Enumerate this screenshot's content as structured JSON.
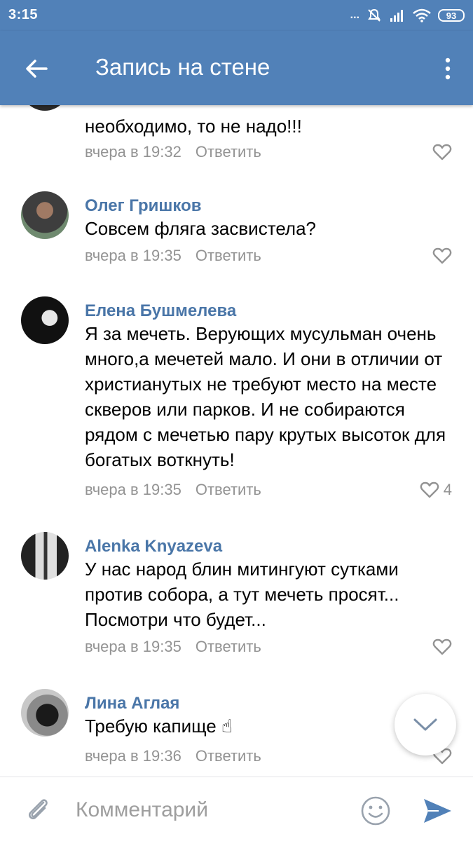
{
  "status_bar": {
    "time": "3:15",
    "signal_dots": "...",
    "battery": "93"
  },
  "toolbar": {
    "title": "Запись на стене",
    "back_icon": "arrow-left-icon",
    "menu_icon": "more-vertical-icon"
  },
  "comments": [
    {
      "author": "",
      "text": "необходимо, то не надо!!!",
      "time": "вчера в 19:32",
      "reply": "Ответить",
      "likes": ""
    },
    {
      "author": "Олег Гришков",
      "text": "Совсем фляга засвистела?",
      "time": "вчера в 19:35",
      "reply": "Ответить",
      "likes": ""
    },
    {
      "author": "Елена Бушмелева",
      "text": "Я за мечеть. Верующих мусульман очень много,а мечетей мало. И они в отличии от христианутых не требуют место на месте скверов или парков. И не собираются рядом с мечетью  пару крутых высоток для богатых воткнуть!",
      "time": "вчера в 19:35",
      "reply": "Ответить",
      "likes": "4"
    },
    {
      "author": "Alenka Knyazeva",
      "text": "У нас народ блин митингуют сутками против собора, а тут мечеть просят... Посмотри что будет...",
      "time": "вчера в 19:35",
      "reply": "Ответить",
      "likes": ""
    },
    {
      "author": "Лина Аглая",
      "text": "Требую капище ☝",
      "time": "вчера в 19:36",
      "reply": "Ответить",
      "likes": ""
    }
  ],
  "input": {
    "placeholder": "Комментарий",
    "attach_icon": "paperclip-icon",
    "emoji_icon": "smile-icon",
    "send_icon": "send-icon"
  },
  "colors": {
    "accent": "#5181b8",
    "author": "#4a76a8",
    "meta": "#939393"
  }
}
